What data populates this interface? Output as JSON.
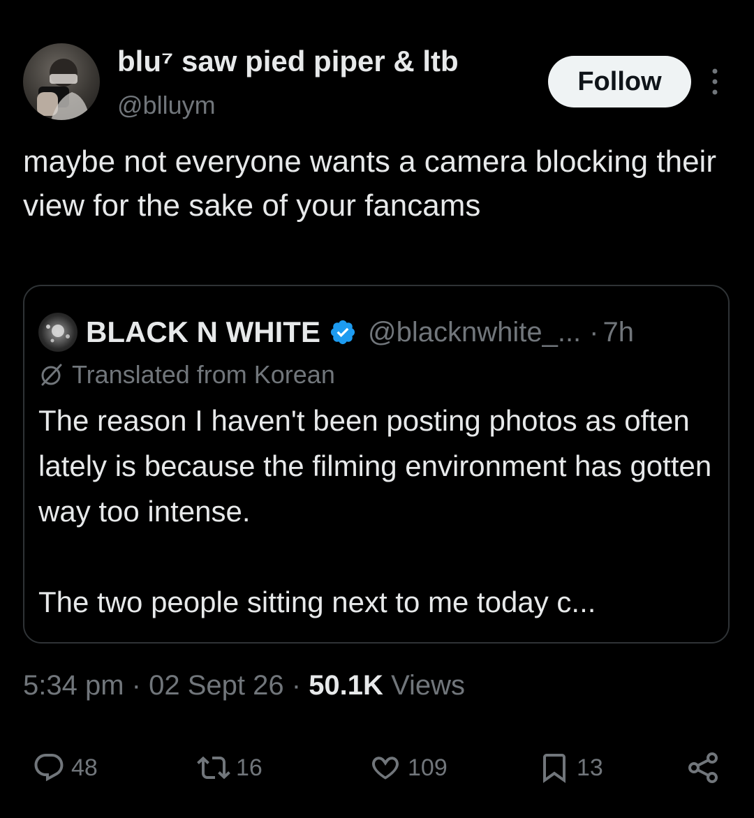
{
  "author": {
    "display_name": "blu⁷ saw pied piper & ltb",
    "handle": "@blluym",
    "avatar_icon": "avatar"
  },
  "follow_label": "Follow",
  "tweet_text": "maybe not everyone wants a camera blocking their view for the sake of your fancams",
  "quote": {
    "name": "BLACK N WHITE",
    "handle": "@blacknwhite_...",
    "dot": "·",
    "time": "7h",
    "translated_label": "Translated from Korean",
    "body_p1": "The reason I haven't been posting photos as often lately is because the filming environment has gotten way too intense.",
    "body_p2": "The two people sitting next to me today c..."
  },
  "meta": {
    "time": "5:34 pm",
    "date": "02 Sept 26",
    "views_count": "50.1K",
    "views_label": "Views",
    "separator": "·"
  },
  "actions": {
    "replies": "48",
    "reposts": "16",
    "likes": "109",
    "bookmarks": "13"
  },
  "colors": {
    "background": "#000000",
    "primary_text": "#e7e9ea",
    "secondary_text": "#71767b",
    "verified_blue": "#1d9bf0",
    "follow_bg": "#eff3f4"
  }
}
